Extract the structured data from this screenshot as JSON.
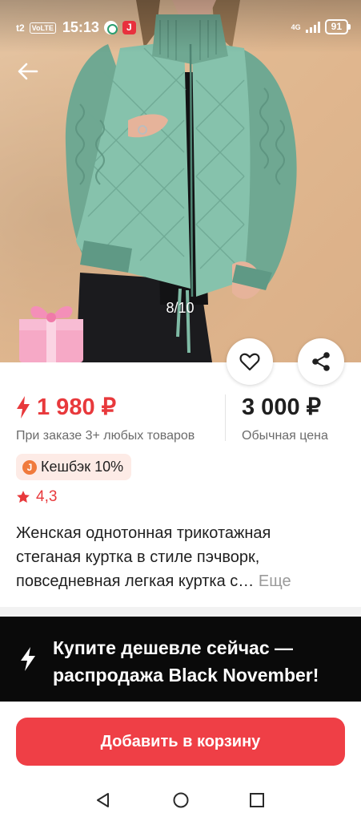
{
  "status_bar": {
    "network": "t2",
    "volte": "VoLTE",
    "time": "15:13",
    "app_icon_2": "J",
    "signal_label": "4G",
    "battery": "91"
  },
  "gallery": {
    "counter": "8/10",
    "icons": [
      "back-arrow-icon",
      "gift-icon",
      "heart-icon",
      "share-icon"
    ]
  },
  "price": {
    "current": "1 980 ₽",
    "current_note": "При заказе 3+ любых товаров",
    "regular": "3 000 ₽",
    "regular_note": "Обычная цена",
    "accent_color": "#e8393c"
  },
  "cashback": {
    "icon_letter": "J",
    "label": "Кешбэк 10%"
  },
  "rating": {
    "value": "4,3"
  },
  "product": {
    "title": "Женская однотонная трикотажная стеганая куртка в стиле пэчворк, повседневная легкая куртка с…",
    "more_label": "Еще"
  },
  "promo": {
    "text": "Купите дешевле сейчас — распродажа Black November!"
  },
  "cart": {
    "button_label": "Добавить в корзину",
    "button_color": "#ef3f46"
  }
}
